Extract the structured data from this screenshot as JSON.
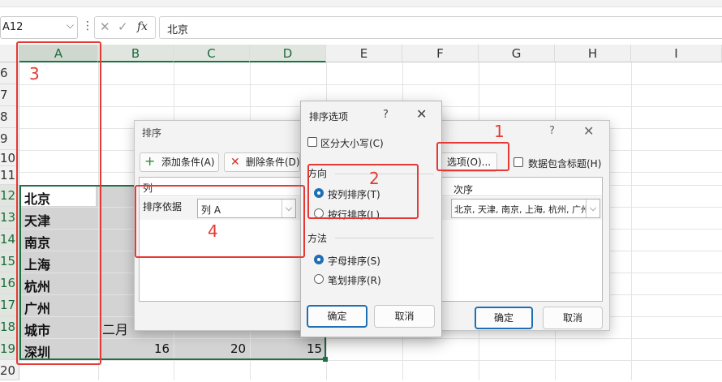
{
  "formula_bar": {
    "name_box": "A12",
    "more_icon": "⋮",
    "cancel_icon": "✕",
    "enter_icon": "✓",
    "fx_label": "fx",
    "content": "北京"
  },
  "grid": {
    "columns": [
      "A",
      "B",
      "C",
      "D",
      "E",
      "F",
      "G",
      "H",
      "I"
    ],
    "rows": [
      "6",
      "7",
      "8",
      "9",
      "10",
      "11",
      "12",
      "13",
      "14",
      "15",
      "16",
      "17",
      "18",
      "19",
      "20"
    ],
    "col_a_values": [
      "北京",
      "天津",
      "南京",
      "上海",
      "杭州",
      "广州",
      "城市",
      "深圳"
    ],
    "row18_b": "二月",
    "row19_values": [
      "16",
      "20",
      "15"
    ]
  },
  "sort_dialog": {
    "title": "排序",
    "help": "?",
    "close": "✕",
    "add_condition": "添加条件(A)",
    "delete_condition": "删除条件(D)",
    "options_button": "选项(O)...",
    "header_checkbox": "数据包含标题(H)",
    "header_checked": false,
    "column_header": "列",
    "order_header": "次序",
    "sort_by_label": "排序依据",
    "sort_by_value": "列 A",
    "order_value": "北京, 天津, 南京, 上海, 杭州, 广州,",
    "ok": "确定",
    "cancel": "取消"
  },
  "options_dialog": {
    "title": "排序选项",
    "help": "?",
    "close": "✕",
    "case_sensitive": "区分大小写(C)",
    "case_checked": false,
    "direction_label": "方向",
    "by_column": "按列排序(T)",
    "by_row": "按行排序(L)",
    "direction_selected": "按列排序(T)",
    "method_label": "方法",
    "alpha": "字母排序(S)",
    "stroke": "笔划排序(R)",
    "method_selected": "字母排序(S)",
    "ok": "确定",
    "cancel": "取消"
  },
  "annotations": [
    "1",
    "2",
    "3",
    "4"
  ],
  "colors": {
    "annotation_red": "#e53935",
    "selection_green": "#1e7145",
    "accent_blue": "#1f6fb5"
  }
}
